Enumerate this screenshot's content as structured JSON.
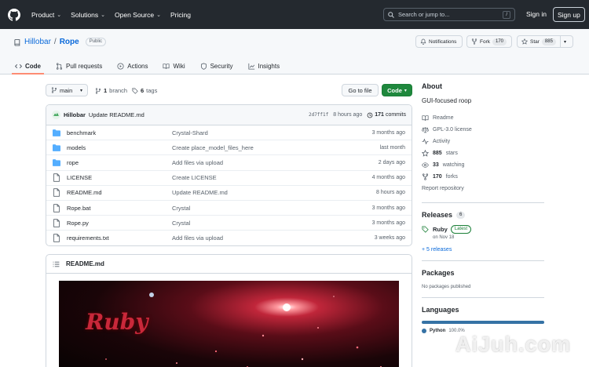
{
  "nav": {
    "items": [
      "Product",
      "Solutions",
      "Open Source",
      "Pricing"
    ],
    "search_placeholder": "Search or jump to...",
    "search_key": "/",
    "sign_in": "Sign in",
    "sign_up": "Sign up"
  },
  "repo": {
    "owner": "Hillobar",
    "separator": "/",
    "name": "Rope",
    "visibility": "Public",
    "notifications_label": "Notifications",
    "fork_label": "Fork",
    "fork_count": "170",
    "star_label": "Star",
    "star_count": "885",
    "tabs": [
      {
        "label": "Code",
        "icon": "code-icon",
        "active": true
      },
      {
        "label": "Pull requests",
        "icon": "pull-request-icon",
        "active": false
      },
      {
        "label": "Actions",
        "icon": "play-icon",
        "active": false
      },
      {
        "label": "Wiki",
        "icon": "book-icon",
        "active": false
      },
      {
        "label": "Security",
        "icon": "shield-icon",
        "active": false
      },
      {
        "label": "Insights",
        "icon": "graph-icon",
        "active": false
      }
    ]
  },
  "toolbar": {
    "branch": "main",
    "branch_count": "1",
    "branch_label": "branch",
    "tag_count": "6",
    "tag_label": "tags",
    "go_to_file": "Go to file",
    "code_button": "Code"
  },
  "commit": {
    "author": "Hillobar",
    "message": "Update README.md",
    "sha": "2d7ff1f",
    "time": "8 hours ago",
    "commit_count": "171",
    "commit_label": "commits"
  },
  "files": [
    {
      "type": "folder",
      "name": "benchmark",
      "message": "Crystal-Shard",
      "age": "3 months ago"
    },
    {
      "type": "folder",
      "name": "models",
      "message": "Create place_model_files_here",
      "age": "last month"
    },
    {
      "type": "folder",
      "name": "rope",
      "message": "Add files via upload",
      "age": "2 days ago"
    },
    {
      "type": "file",
      "name": "LICENSE",
      "message": "Create LICENSE",
      "age": "4 months ago"
    },
    {
      "type": "file",
      "name": "README.md",
      "message": "Update README.md",
      "age": "8 hours ago"
    },
    {
      "type": "file",
      "name": "Rope.bat",
      "message": "Crystal",
      "age": "3 months ago"
    },
    {
      "type": "file",
      "name": "Rope.py",
      "message": "Crystal",
      "age": "3 months ago"
    },
    {
      "type": "file",
      "name": "requirements.txt",
      "message": "Add files via upload",
      "age": "3 weeks ago"
    }
  ],
  "readme": {
    "title": "README.md",
    "banner_text": "Ruby"
  },
  "about": {
    "heading": "About",
    "description": "GUI-focused roop",
    "readme": "Readme",
    "license": "GPL-3.0 license",
    "activity": "Activity",
    "stars_count": "885",
    "stars_label": "stars",
    "watching_count": "33",
    "watching_label": "watching",
    "forks_count": "170",
    "forks_label": "forks",
    "report": "Report repository"
  },
  "releases": {
    "heading": "Releases",
    "count": "6",
    "latest_name": "Ruby",
    "latest_badge": "Latest",
    "latest_date": "on Nov 18",
    "more": "+ 5 releases"
  },
  "packages": {
    "heading": "Packages",
    "note": "No packages published"
  },
  "languages": {
    "heading": "Languages",
    "primary_name": "Python",
    "primary_pct": "100.0%",
    "primary_color": "#3572a5"
  },
  "watermark": "AiJuh.com",
  "colors": {
    "accent": "#0969da",
    "header_bg": "#24292f",
    "primary_button": "#1f883d",
    "active_tab": "#fd8c73"
  }
}
